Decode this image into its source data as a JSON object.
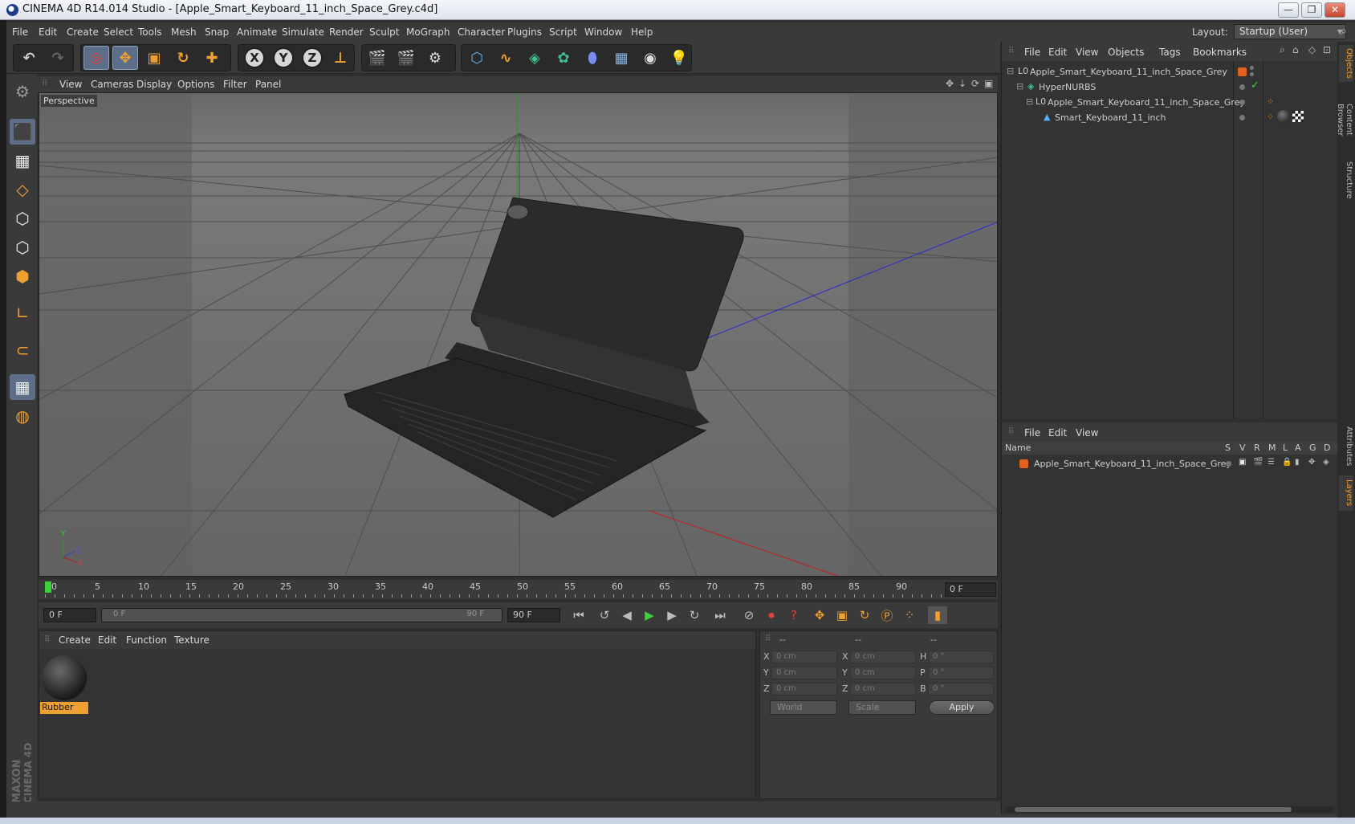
{
  "window": {
    "title": "CINEMA 4D R14.014 Studio - [Apple_Smart_Keyboard_11_inch_Space_Grey.c4d]",
    "buttons": [
      "—",
      "❐",
      "✕"
    ]
  },
  "menubar": {
    "items": [
      "File",
      "Edit",
      "Create",
      "Select",
      "Tools",
      "Mesh",
      "Snap",
      "Animate",
      "Simulate",
      "Render",
      "Sculpt",
      "MoGraph",
      "Character",
      "Plugins",
      "Script",
      "Window",
      "Help"
    ],
    "layout_label": "Layout:",
    "layout_value": "Startup (User)"
  },
  "toolbar": {
    "axis_x": "X",
    "axis_y": "Y",
    "axis_z": "Z"
  },
  "viewport": {
    "menu": [
      "View",
      "Cameras",
      "Display",
      "Options",
      "Filter",
      "Panel"
    ],
    "label": "Perspective",
    "gizmo_y": "Y",
    "gizmo_z": "Z",
    "gizmo_x": "X"
  },
  "timeline": {
    "ticks": [
      "0",
      "5",
      "10",
      "15",
      "20",
      "25",
      "30",
      "35",
      "40",
      "45",
      "50",
      "55",
      "60",
      "65",
      "70",
      "75",
      "80",
      "85",
      "90"
    ],
    "current_frame": "0 F",
    "start_frame": "0 F",
    "range_start": "0 F",
    "range_end": "90 F",
    "end_frame": "90 F"
  },
  "materials": {
    "menu": [
      "Create",
      "Edit",
      "Function",
      "Texture"
    ],
    "items": [
      {
        "name": "Rubber"
      }
    ]
  },
  "coordinates": {
    "headers": [
      "--",
      "--",
      "--"
    ],
    "rows": [
      {
        "l1": "X",
        "v1": "0 cm",
        "l2": "X",
        "v2": "0 cm",
        "l3": "H",
        "v3": "0 °"
      },
      {
        "l1": "Y",
        "v1": "0 cm",
        "l2": "Y",
        "v2": "0 cm",
        "l3": "P",
        "v3": "0 °"
      },
      {
        "l1": "Z",
        "v1": "0 cm",
        "l2": "Z",
        "v2": "0 cm",
        "l3": "B",
        "v3": "0 °"
      }
    ],
    "mode": "World",
    "type": "Scale",
    "apply": "Apply"
  },
  "objects": {
    "menu": [
      "File",
      "Edit",
      "View",
      "Objects",
      "Tags",
      "Bookmarks"
    ],
    "tree": [
      {
        "name": "Apple_Smart_Keyboard_11_inch_Space_Grey"
      },
      {
        "name": "HyperNURBS"
      },
      {
        "name": "Apple_Smart_Keyboard_11_inch_Space_Grey"
      },
      {
        "name": "Smart_Keyboard_11_inch"
      }
    ]
  },
  "layers": {
    "menu": [
      "File",
      "Edit",
      "View"
    ],
    "columns": [
      "Name",
      "S",
      "V",
      "R",
      "M",
      "L",
      "A",
      "G",
      "D"
    ],
    "rows": [
      {
        "name": "Apple_Smart_Keyboard_11_inch_Space_Grey"
      }
    ]
  },
  "side_tabs": [
    "Objects",
    "Content Browser",
    "Structure",
    "Attributes",
    "Layers"
  ],
  "branding": {
    "maxon": "MAXON",
    "product": "CINEMA 4D"
  },
  "colors": {
    "accent": "#f0a030",
    "selected_tool": "#5d6f88",
    "layer_color": "#e06020"
  }
}
